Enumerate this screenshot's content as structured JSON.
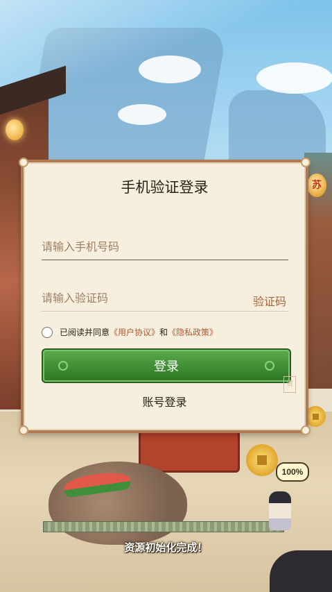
{
  "login": {
    "title": "手机验证登录",
    "phone_placeholder": "请输入手机号码",
    "code_placeholder": "请输入验证码",
    "get_code_label": "验证码",
    "agreement_prefix": "已阅读并同意",
    "user_agreement": "《用户协议》",
    "agreement_and": "和",
    "privacy_policy": "《隐私政策》",
    "login_button": "登录",
    "account_login": "账号登录",
    "seal_text": "贵"
  },
  "lantern_text": "苏",
  "loading": {
    "percent_label": "100%",
    "progress": 1.0,
    "status_text": "资源初始化完成！"
  },
  "colors": {
    "accent_green": "#3d8a32",
    "link_brown": "#b05a34",
    "panel_bg": "#f6efdd",
    "panel_border": "#b07a52"
  }
}
